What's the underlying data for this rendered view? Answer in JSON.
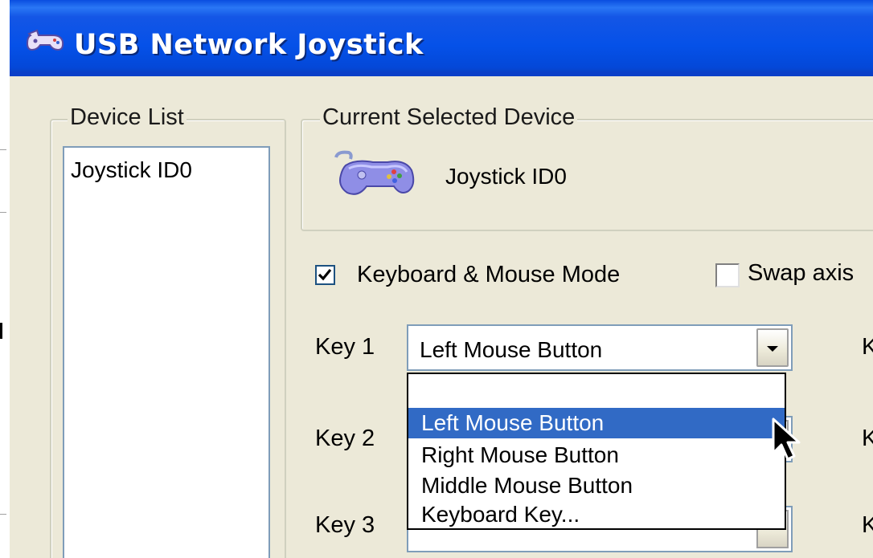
{
  "window": {
    "title": "USB Network Joystick"
  },
  "device_list": {
    "legend": "Device List",
    "items": [
      "Joystick ID0"
    ]
  },
  "current_device": {
    "legend": "Current Selected Device",
    "name": "Joystick ID0",
    "icon": "gamepad-icon"
  },
  "options": {
    "keyboard_mouse_mode": {
      "label": "Keyboard & Mouse Mode",
      "checked": true
    },
    "swap_axis": {
      "label": "Swap axis",
      "checked": false
    }
  },
  "keys": [
    {
      "label": "Key 1",
      "value": "Left Mouse Button"
    },
    {
      "label": "Key 2",
      "value": ""
    },
    {
      "label": "Key 3",
      "value": ""
    }
  ],
  "right_column_labels": [
    "K",
    "K",
    "K"
  ],
  "key1_dropdown": {
    "options": [
      "",
      "Left Mouse Button",
      "Right Mouse Button",
      "Middle Mouse Button",
      "Keyboard Key..."
    ],
    "highlighted": "Left Mouse Button"
  },
  "colors": {
    "title_bar": "#0551e8",
    "window_bg": "#ece9d8",
    "highlight": "#316ac5",
    "checkbox_border": "#1c5180"
  }
}
